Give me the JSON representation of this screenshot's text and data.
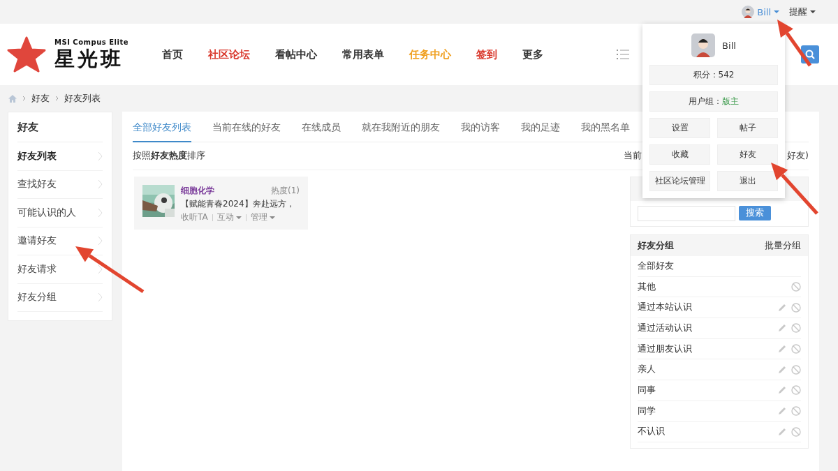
{
  "top_bar": {
    "user": "Bill",
    "reminder": "提醒"
  },
  "header": {
    "logo_subtitle": "MSI Compus Elite",
    "logo_title": "星光班",
    "nav": [
      {
        "label": "首页",
        "color": "#333333"
      },
      {
        "label": "社区论坛",
        "color": "#d9372b"
      },
      {
        "label": "看帖中心",
        "color": "#333333"
      },
      {
        "label": "常用表单",
        "color": "#333333"
      },
      {
        "label": "任务中心",
        "color": "#f0a020"
      },
      {
        "label": "签到",
        "color": "#d9372b"
      },
      {
        "label": "更多",
        "color": "#333333"
      }
    ]
  },
  "breadcrumb": [
    "好友",
    "好友列表"
  ],
  "sidebar": {
    "title": "好友",
    "items": [
      {
        "label": "好友列表",
        "selected": true
      },
      {
        "label": "查找好友",
        "selected": false
      },
      {
        "label": "可能认识的人",
        "selected": false
      },
      {
        "label": "邀请好友",
        "selected": false
      },
      {
        "label": "好友请求",
        "selected": false
      },
      {
        "label": "好友分组",
        "selected": false
      }
    ]
  },
  "tabs": [
    {
      "label": "全部好友列表",
      "selected": true
    },
    {
      "label": "当前在线的好友",
      "selected": false
    },
    {
      "label": "在线成员",
      "selected": false
    },
    {
      "label": "就在我附近的朋友",
      "selected": false
    },
    {
      "label": "我的访客",
      "selected": false
    },
    {
      "label": "我的足迹",
      "selected": false
    },
    {
      "label": "我的黑名单",
      "selected": false
    }
  ],
  "sort_text": "按照**好友热度**排序",
  "count_text_start": "当前",
  "count_text_end": "好友)",
  "friends": [
    {
      "name": "细胞化学",
      "heat": "热度(1)",
      "status": "【赋能青春2024】奔赴远方，",
      "actions": [
        "收听TA",
        "互动",
        "管理"
      ]
    }
  ],
  "search": {
    "button": "搜索"
  },
  "groups": {
    "title": "好友分组",
    "action": "批量分组",
    "items": [
      {
        "label": "全部好友",
        "editable": false,
        "deletable": false
      },
      {
        "label": "其他",
        "editable": false,
        "deletable": true
      },
      {
        "label": "通过本站认识",
        "editable": true,
        "deletable": true
      },
      {
        "label": "通过活动认识",
        "editable": true,
        "deletable": true
      },
      {
        "label": "通过朋友认识",
        "editable": true,
        "deletable": true
      },
      {
        "label": "亲人",
        "editable": true,
        "deletable": true
      },
      {
        "label": "同事",
        "editable": true,
        "deletable": true
      },
      {
        "label": "同学",
        "editable": true,
        "deletable": true
      },
      {
        "label": "不认识",
        "editable": true,
        "deletable": true
      }
    ]
  },
  "user_menu": {
    "name": "Bill",
    "points": "积分：542",
    "group_label": "用户组：",
    "group_value": "版主",
    "buttons": [
      "设置",
      "帖子",
      "收藏",
      "好友",
      "社区论坛管理",
      "退出"
    ]
  }
}
